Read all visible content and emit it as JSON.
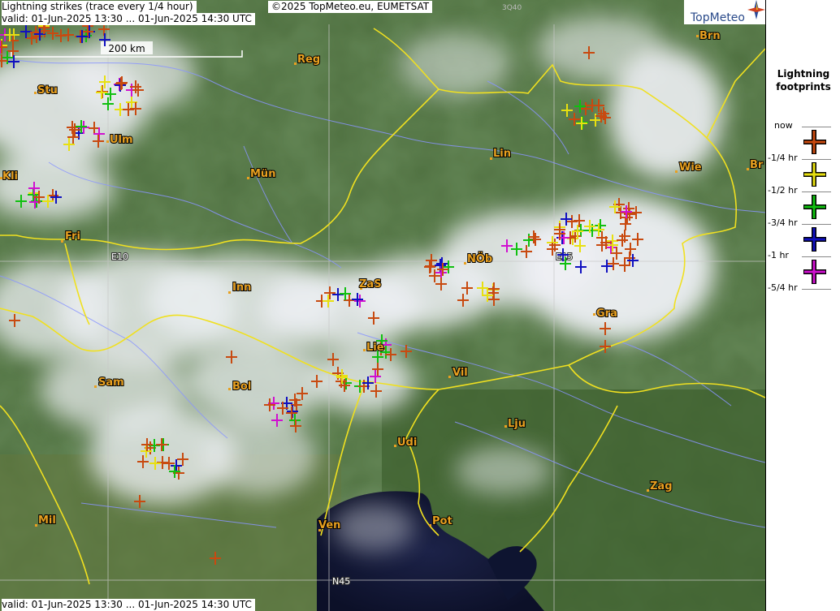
{
  "header": {
    "title": "Lightning strikes (trace every 1/4 hour)",
    "valid_top": "valid:  01-Jun-2025 13:30 ... 01-Jun-2025 14:30 UTC",
    "copyright": "©2025 TopMeteo.eu, EUMETSAT",
    "code": "3Q40",
    "brand": "TopMeteo"
  },
  "footer": {
    "valid_bottom": "valid:  01-Jun-2025 13:30 ... 01-Jun-2025 14:30 UTC"
  },
  "scale_label": "200 km",
  "grid_labels": {
    "e10": "E10",
    "e15": "E15",
    "n45": "N45"
  },
  "cities": [
    {
      "name": "Brn"
    },
    {
      "name": "Reg"
    },
    {
      "name": "Stu"
    },
    {
      "name": "Ulm"
    },
    {
      "name": "Lin"
    },
    {
      "name": "Wie"
    },
    {
      "name": "Br"
    },
    {
      "name": "Kli"
    },
    {
      "name": "Mün"
    },
    {
      "name": "Fri"
    },
    {
      "name": "NÖb"
    },
    {
      "name": "Inn"
    },
    {
      "name": "ZaS"
    },
    {
      "name": "Gra"
    },
    {
      "name": "Lie"
    },
    {
      "name": "Vil"
    },
    {
      "name": "Sam"
    },
    {
      "name": "Bol"
    },
    {
      "name": "Lju"
    },
    {
      "name": "Udi"
    },
    {
      "name": "Zag"
    },
    {
      "name": "Mil"
    },
    {
      "name": "Ven"
    },
    {
      "name": "Pot"
    }
  ],
  "legend": {
    "title_line1": "Lightning",
    "title_line2": "footprints",
    "items": [
      {
        "label": "now",
        "color": "#c84a10"
      },
      {
        "label": "-1/4 hr",
        "color": "#e8e010"
      },
      {
        "label": "-1/2 hr",
        "color": "#10c010"
      },
      {
        "label": "-3/4 hr",
        "color": "#1010c0"
      },
      {
        "label": "-1 hr",
        "color": "#d010d0"
      },
      {
        "label": "-5/4 hr",
        "color": ""
      }
    ]
  },
  "colors": {
    "border": "#f0e020",
    "river": "#8090ff",
    "sea": "#14183a",
    "land": "#4a6a3a"
  }
}
